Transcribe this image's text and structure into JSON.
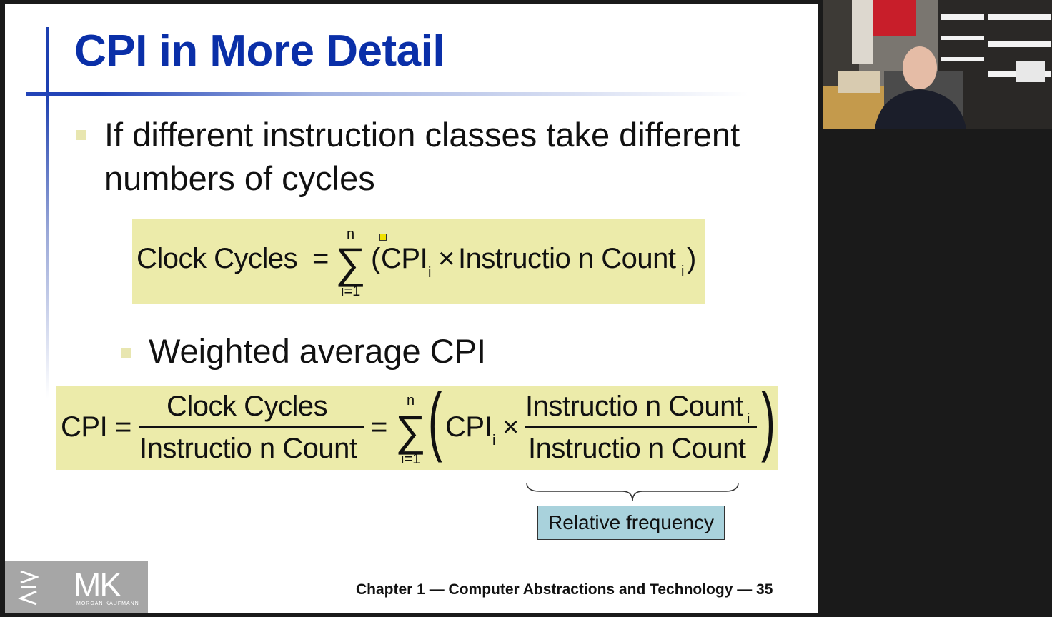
{
  "slide": {
    "title": "CPI in More Detail",
    "bullet1": "If different instruction classes take different numbers of cycles",
    "bullet2": "Weighted average CPI",
    "footer": "Chapter 1 — Computer Abstractions and Technology — 35",
    "relative_frequency": "Relative frequency",
    "logo_text": "MK",
    "logo_subtext": "MORGAN KAUFMANN",
    "eq1": {
      "lhs": "Clock Cycles",
      "eq": "=",
      "sum_top": "n",
      "sum_bottom": "i=1",
      "open": "(",
      "cpi": "CPI",
      "sub_i": "i",
      "times": "×",
      "ic": "Instructio n Count",
      "close": ")"
    },
    "eq2": {
      "lhs": "CPI",
      "eq": "=",
      "num": "Clock Cycles",
      "den": "Instructio n Count",
      "eq2": "=",
      "sum_top": "n",
      "sum_bottom": "i=1",
      "cpi": "CPI",
      "sub_i": "i",
      "times": "×",
      "inner_num": "Instructio n Count",
      "inner_den": "Instructio n Count"
    }
  },
  "colors": {
    "title": "#0a2fa8",
    "eq_box": "#ecebaa",
    "rel_box": "#a9d2dc",
    "bullet": "#e8e6b0"
  }
}
